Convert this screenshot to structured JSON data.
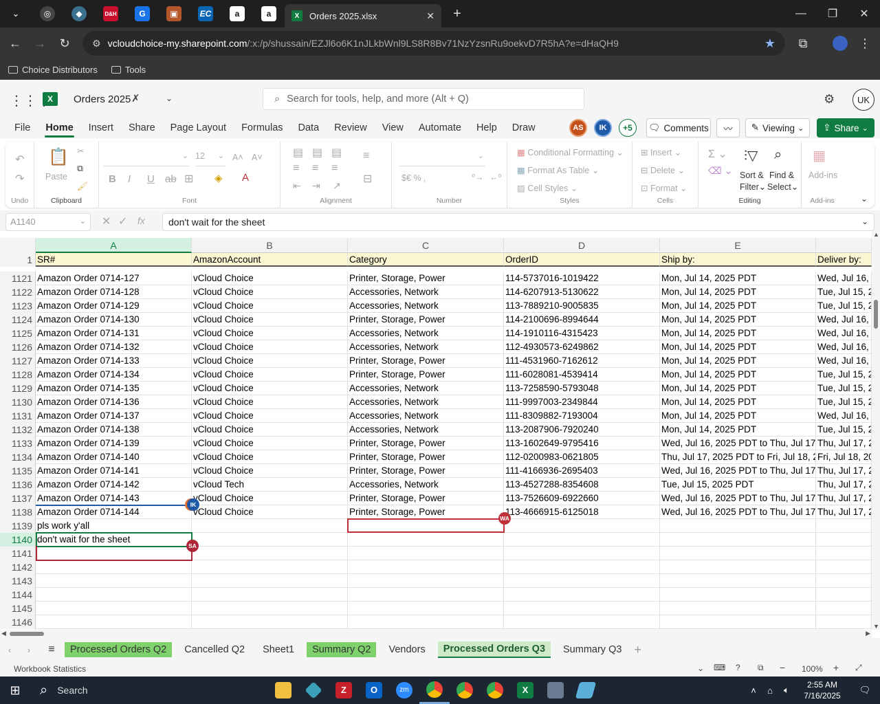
{
  "browser": {
    "tab_title": "Orders 2025.xlsx",
    "pinned_tabs": [
      "dashboard-icon",
      "cloud-icon",
      "dell-icon",
      "google-icon",
      "box-icon",
      "ec-icon",
      "amazon-icon",
      "amazon-icon"
    ],
    "url_domain": "vcloudchoice-my.sharepoint.com",
    "url_path": "/:x:/p/shussain/EZJl6o6K1nJLkbWnl9LS8R8Bv71NzYzsnRu9oekvD7R5hA?e=dHaQH9",
    "bookmarks": [
      "Choice Distributors",
      "Tools"
    ]
  },
  "excel": {
    "file_name": "Orders 2025",
    "search_placeholder": "Search for tools, help, and more (Alt + Q)",
    "user_initials": "UK",
    "collaborators": [
      {
        "initials": "AS",
        "color": "#c4501c"
      },
      {
        "initials": "IK",
        "color": "#1e5aa8"
      }
    ],
    "collab_more": "+5",
    "comments_label": "Comments",
    "viewing_label": "Viewing",
    "share_label": "Share",
    "ribbon_tabs": [
      "File",
      "Home",
      "Insert",
      "Share",
      "Page Layout",
      "Formulas",
      "Data",
      "Review",
      "View",
      "Automate",
      "Help",
      "Draw"
    ],
    "active_tab": "Home",
    "ribbon": {
      "undo_label": "Undo",
      "clipboard_label": "Clipboard",
      "paste_label": "Paste",
      "font_label": "Font",
      "font_size": "12",
      "alignment_label": "Alignment",
      "number_label": "Number",
      "number_symbols": "$€  %  ‚  ",
      "conditional_formatting": "Conditional Formatting",
      "format_as_table": "Format As Table",
      "cell_styles": "Cell Styles",
      "styles_label": "Styles",
      "insert": "Insert",
      "delete": "Delete",
      "format": "Format",
      "cells_label": "Cells",
      "sort_filter_1": "Sort &",
      "sort_filter_2": "Filter",
      "find_select_1": "Find &",
      "find_select_2": "Select",
      "editing_label": "Editing",
      "addins": "Add-ins",
      "addins_label": "Add-ins"
    },
    "name_box": "A1140",
    "formula": "don't wait for the sheet",
    "columns": [
      "A",
      "B",
      "C",
      "D",
      "E"
    ],
    "header_row_number": "1",
    "header_row": [
      "SR#",
      "AmazonAccount",
      "Category",
      "OrderID",
      "Ship by:",
      "Deliver by:"
    ],
    "rows": [
      {
        "n": "1121",
        "a": "Amazon Order 0714-127",
        "b": "vCloud Choice",
        "c": "Printer, Storage, Power",
        "d": "114-5737016-1019422",
        "e": "Mon, Jul 14, 2025 PDT",
        "f": "Wed, Jul 16, 2"
      },
      {
        "n": "1122",
        "a": "Amazon Order 0714-128",
        "b": "vCloud Choice",
        "c": "Accessories, Network",
        "d": "114-6207913-5130622",
        "e": "Mon, Jul 14, 2025 PDT",
        "f": "Tue, Jul 15, 20"
      },
      {
        "n": "1123",
        "a": "Amazon Order 0714-129",
        "b": "vCloud Choice",
        "c": "Accessories, Network",
        "d": "113-7889210-9005835",
        "e": "Mon, Jul 14, 2025 PDT",
        "f": "Tue, Jul 15, 20"
      },
      {
        "n": "1124",
        "a": "Amazon Order 0714-130",
        "b": "vCloud Choice",
        "c": "Printer, Storage, Power",
        "d": "114-2100696-8994644",
        "e": "Mon, Jul 14, 2025 PDT",
        "f": "Wed, Jul 16, 2"
      },
      {
        "n": "1125",
        "a": "Amazon Order 0714-131",
        "b": "vCloud Choice",
        "c": "Accessories, Network",
        "d": "114-1910116-4315423",
        "e": "Mon, Jul 14, 2025 PDT",
        "f": "Wed, Jul 16, 2"
      },
      {
        "n": "1126",
        "a": "Amazon Order 0714-132",
        "b": "vCloud Choice",
        "c": "Accessories, Network",
        "d": "112-4930573-6249862",
        "e": "Mon, Jul 14, 2025 PDT",
        "f": "Wed, Jul 16, 2"
      },
      {
        "n": "1127",
        "a": "Amazon Order 0714-133",
        "b": "vCloud Choice",
        "c": "Printer, Storage, Power",
        "d": "111-4531960-7162612",
        "e": "Mon, Jul 14, 2025 PDT",
        "f": "Wed, Jul 16, 2"
      },
      {
        "n": "1128",
        "a": "Amazon Order 0714-134",
        "b": "vCloud Choice",
        "c": "Printer, Storage, Power",
        "d": "111-6028081-4539414",
        "e": "Mon, Jul 14, 2025 PDT",
        "f": "Tue, Jul 15, 20"
      },
      {
        "n": "1129",
        "a": "Amazon Order 0714-135",
        "b": "vCloud Choice",
        "c": "Accessories, Network",
        "d": "113-7258590-5793048",
        "e": "Mon, Jul 14, 2025 PDT",
        "f": "Tue, Jul 15, 20"
      },
      {
        "n": "1130",
        "a": "Amazon Order 0714-136",
        "b": "vCloud Choice",
        "c": "Accessories, Network",
        "d": "111-9997003-2349844",
        "e": "Mon, Jul 14, 2025 PDT",
        "f": "Tue, Jul 15, 20"
      },
      {
        "n": "1131",
        "a": "Amazon Order 0714-137",
        "b": "vCloud Choice",
        "c": "Accessories, Network",
        "d": "111-8309882-7193004",
        "e": "Mon, Jul 14, 2025 PDT",
        "f": "Wed, Jul 16, 2"
      },
      {
        "n": "1132",
        "a": "Amazon Order 0714-138",
        "b": "vCloud Choice",
        "c": "Accessories, Network",
        "d": "113-2087906-7920240",
        "e": "Mon, Jul 14, 2025 PDT",
        "f": "Tue, Jul 15, 20"
      },
      {
        "n": "1133",
        "a": "Amazon Order 0714-139",
        "b": "vCloud Choice",
        "c": "Printer, Storage, Power",
        "d": "113-1602649-9795416",
        "e": "Wed, Jul 16, 2025 PDT to Thu, Jul 17, 2",
        "f": "Thu, Jul 17, 20"
      },
      {
        "n": "1134",
        "a": "Amazon Order 0714-140",
        "b": "vCloud Choice",
        "c": "Printer, Storage, Power",
        "d": "112-0200983-0621805",
        "e": "Thu, Jul 17, 2025 PDT to Fri, Jul 18, 20",
        "f": "Fri, Jul 18, 20"
      },
      {
        "n": "1135",
        "a": "Amazon Order 0714-141",
        "b": "vCloud Choice",
        "c": "Printer, Storage, Power",
        "d": "111-4166936-2695403",
        "e": "Wed, Jul 16, 2025 PDT to Thu, Jul 17, 2",
        "f": "Thu, Jul 17, 20"
      },
      {
        "n": "1136",
        "a": "Amazon Order 0714-142",
        "b": "vCloud Tech",
        "c": "Accessories, Network",
        "d": "113-4527288-8354608",
        "e": "Tue, Jul 15, 2025 PDT",
        "f": "Thu, Jul 17, 20"
      },
      {
        "n": "1137",
        "a": "Amazon Order 0714-143",
        "b": "vCloud Choice",
        "c": "Printer, Storage, Power",
        "d": "113-7526609-6922660",
        "e": "Wed, Jul 16, 2025 PDT to Thu, Jul 17, 2",
        "f": "Thu, Jul 17, 20"
      },
      {
        "n": "1138",
        "a": "Amazon Order 0714-144",
        "b": "vCloud Choice",
        "c": "Printer, Storage, Power",
        "d": "113-4666915-6125018",
        "e": "Wed, Jul 16, 2025 PDT to Thu, Jul 17, 2",
        "f": "Thu, Jul 17, 20"
      },
      {
        "n": "1139",
        "a": "pls work y'all",
        "b": "",
        "c": "",
        "d": "",
        "e": "",
        "f": ""
      },
      {
        "n": "1140",
        "a": "don't wait for the sheet",
        "b": "",
        "c": "",
        "d": "",
        "e": "",
        "f": ""
      },
      {
        "n": "1141",
        "a": "",
        "b": "",
        "c": "",
        "d": "",
        "e": "",
        "f": ""
      },
      {
        "n": "1142",
        "a": "",
        "b": "",
        "c": "",
        "d": "",
        "e": "",
        "f": ""
      },
      {
        "n": "1143",
        "a": "",
        "b": "",
        "c": "",
        "d": "",
        "e": "",
        "f": ""
      },
      {
        "n": "1144",
        "a": "",
        "b": "",
        "c": "",
        "d": "",
        "e": "",
        "f": ""
      },
      {
        "n": "1145",
        "a": "",
        "b": "",
        "c": "",
        "d": "",
        "e": "",
        "f": ""
      },
      {
        "n": "1146",
        "a": "",
        "b": "",
        "c": "",
        "d": "",
        "e": "",
        "f": ""
      }
    ],
    "cursor_tags": [
      {
        "initials": "IK",
        "color": "#1e5aa8"
      },
      {
        "initials": "WA",
        "color": "#c0303a"
      },
      {
        "initials": "SA",
        "color": "#b0253a"
      }
    ],
    "sheet_tabs": [
      {
        "label": "Processed Orders Q2",
        "style": "green"
      },
      {
        "label": "Cancelled Q2",
        "style": ""
      },
      {
        "label": "Sheet1",
        "style": ""
      },
      {
        "label": "Summary Q2",
        "style": "green"
      },
      {
        "label": "Vendors",
        "style": ""
      },
      {
        "label": "Processed Orders Q3",
        "style": "active"
      },
      {
        "label": "Summary Q3",
        "style": ""
      }
    ],
    "status_left": "Workbook Statistics",
    "zoom": "100%"
  },
  "taskbar": {
    "search_label": "Search",
    "time": "2:55 AM",
    "date": "7/16/2025"
  }
}
